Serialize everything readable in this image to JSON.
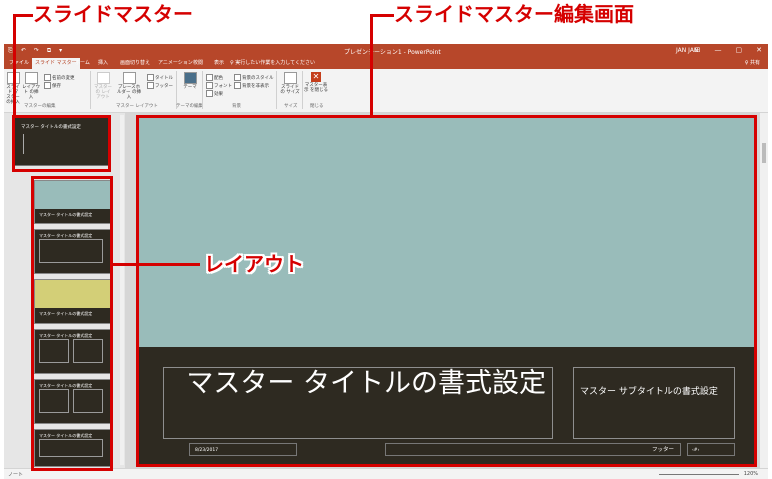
{
  "annotations": {
    "slide_master": "スライドマスター",
    "slide_master_edit_screen": "スライドマスター編集画面",
    "layout": "レイアウト"
  },
  "window": {
    "title": "プレゼンテーション1 - PowerPoint",
    "user": "JAN JAN",
    "qat": [
      "⎘",
      "↶",
      "↷",
      "⧉",
      "▾"
    ],
    "buttons": [
      "⊟",
      "—",
      "▢",
      "✕"
    ]
  },
  "tabs": {
    "items": [
      "ファイル",
      "スライド マスター",
      "ホーム",
      "挿入",
      "画面切り替え",
      "アニメーション",
      "校閲",
      "表示"
    ],
    "tellme": "♀ 実行したい作業を入力してください",
    "share": "♀ 共有"
  },
  "ribbon": {
    "insert_master": "スライド マスター の挿入",
    "insert_layout": "レイアウト の挿入",
    "rename": "名前の変更",
    "preserve": "保存",
    "master_layout": "マスターの レイアウト",
    "insert_placeholder": "プレースホルダー の挿入",
    "title_check": "タイトル",
    "footer_check": "フッター",
    "theme": "テーマ",
    "colors": "配色",
    "fonts": "フォント",
    "effects": "効果",
    "bg_styles": "背景のスタイル",
    "hide_bg": "背景を非表示",
    "slide_size": "スライドの サイズ",
    "close_master": "マスター表示 を閉じる",
    "groups": {
      "edit_master": "マスターの編集",
      "master_layout": "マスター レイアウト",
      "edit_theme": "テーマの編集",
      "background": "背景",
      "size": "サイズ",
      "close": "閉じる"
    }
  },
  "thumbs": {
    "master_title": "マスター タイトルの書式設定",
    "layout_title": "マスター タイトルの書式設定"
  },
  "slide": {
    "title": "マスター タイトルの書式設定",
    "subtitle": "マスター サブタイトルの書式設定",
    "date": "8/23/2017",
    "footer": "フッター",
    "number": "‹#›"
  },
  "status": {
    "left": "ノート",
    "zoom": "120%"
  },
  "colors": {
    "accent": "#b7472a",
    "slide_top": "#99bcba",
    "slide_bottom": "#2e2a21",
    "annotation": "#d50000"
  }
}
